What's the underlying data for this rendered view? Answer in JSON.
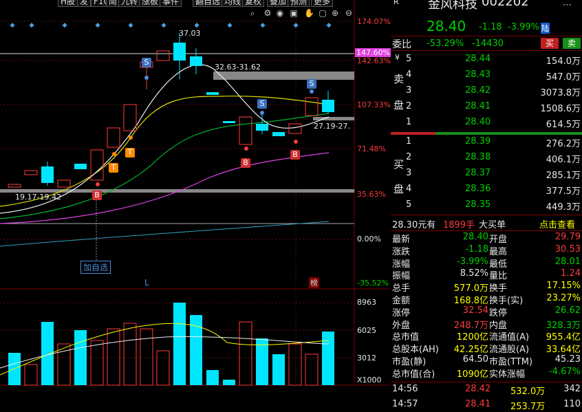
{
  "toolbar": {
    "items": [
      "H股",
      "发",
      "F10",
      "简",
      "九转",
      "涨板",
      "事件",
      "翻自选",
      "均线",
      "复权",
      "叠加",
      "预测",
      "更多"
    ]
  },
  "chart": {
    "price_axis": [
      "174.07%",
      "147.60%",
      "142.63%",
      "107.33%",
      "71.48%",
      "35.63%",
      "0.00%",
      "-35.52%"
    ],
    "volume_axis": [
      "8963",
      "6025",
      "3012",
      "X1000"
    ],
    "annotations": {
      "high": "37.03",
      "range_top": "32.63-31.62",
      "range_mid": "27.19-27.",
      "range_low": "19.17-19.42",
      "add_watch": "加自选",
      "L": "L",
      "rank": "榜"
    },
    "signals": [
      "S",
      "S",
      "S",
      "B",
      "B",
      "B",
      "T",
      "T"
    ]
  },
  "stock": {
    "name": "金风科技",
    "code": "002202",
    "market_tag": "R",
    "price": "28.40",
    "change": "-1.18",
    "pct": "-3.99%",
    "exchange": "陆",
    "weibi_label": "委比",
    "weibi": "-53.29%",
    "weicha": "-14430",
    "sell_btn": "买",
    "buy_btn": "卖"
  },
  "orderbook": {
    "sell_label": [
      "卖",
      "盘"
    ],
    "buy_label": [
      "买",
      "盘"
    ],
    "yen": "¥",
    "asks": [
      {
        "lvl": "5",
        "price": "28.44",
        "vol": "154.0万"
      },
      {
        "lvl": "4",
        "price": "28.43",
        "vol": "547.0万"
      },
      {
        "lvl": "3",
        "price": "28.42",
        "vol": "3073.8万"
      },
      {
        "lvl": "2",
        "price": "28.41",
        "vol": "1508.6万"
      },
      {
        "lvl": "1",
        "price": "28.40",
        "vol": "614.5万"
      }
    ],
    "bids": [
      {
        "lvl": "1",
        "price": "28.39",
        "vol": "276.2万"
      },
      {
        "lvl": "2",
        "price": "28.38",
        "vol": "406.1万"
      },
      {
        "lvl": "3",
        "price": "28.37",
        "vol": "285.1万"
      },
      {
        "lvl": "4",
        "price": "28.36",
        "vol": "377.5万"
      },
      {
        "lvl": "5",
        "price": "28.35",
        "vol": "449.3万"
      }
    ]
  },
  "bigorder": {
    "price": "28.30元有",
    "hands": "1899手",
    "label": "大买单",
    "link": "点击查看"
  },
  "stats": [
    {
      "l": "最新",
      "v": "28.40",
      "vc": "green",
      "l2": "开盘",
      "v2": "29.79",
      "v2c": "red"
    },
    {
      "l": "涨跌",
      "v": "-1.18",
      "vc": "green",
      "l2": "最高",
      "v2": "30.53",
      "v2c": "red"
    },
    {
      "l": "涨幅",
      "v": "-3.99%",
      "vc": "green",
      "l2": "最低",
      "v2": "28.01",
      "v2c": "green"
    },
    {
      "l": "振幅",
      "v": "8.52%",
      "vc": "white",
      "l2": "量比",
      "v2": "1.24",
      "v2c": "red"
    },
    {
      "l": "总手",
      "v": "577.0万",
      "vc": "yellow",
      "l2": "换手",
      "v2": "17.15%",
      "v2c": "yellow"
    },
    {
      "l": "金额",
      "v": "168.8亿",
      "vc": "yellow",
      "l2": "换手(实)",
      "v2": "23.27%",
      "v2c": "yellow"
    },
    {
      "l": "涨停",
      "v": "32.54",
      "vc": "red",
      "l2": "跌停",
      "v2": "26.62",
      "v2c": "green"
    },
    {
      "l": "外盘",
      "v": "248.7万",
      "vc": "red",
      "l2": "内盘",
      "v2": "328.3万",
      "v2c": "green"
    },
    {
      "l": "总市值",
      "v": "1200亿",
      "vc": "yellow",
      "l2": "流通值(A)",
      "v2": "955.4亿",
      "v2c": "yellow"
    },
    {
      "l": "总股本(AH)",
      "v": "42.25亿",
      "vc": "yellow",
      "l2": "流通股(A)",
      "v2": "33.64亿",
      "v2c": "yellow"
    },
    {
      "l": "市盈(静)",
      "v": "64.50",
      "vc": "white",
      "l2": "市盈(TTM)",
      "v2": "45.23",
      "v2c": "white"
    },
    {
      "l": "总市值(合)",
      "v": "1090亿",
      "vc": "yellow",
      "l2": "实体涨幅",
      "v2": "-4.67%",
      "v2c": "green"
    }
  ],
  "ticks": [
    {
      "t": "14:56",
      "p": "28.42",
      "v": "532.0万",
      "n": "342"
    },
    {
      "t": "14:57",
      "p": "28.41",
      "v": "253.7万",
      "n": "110"
    }
  ]
}
